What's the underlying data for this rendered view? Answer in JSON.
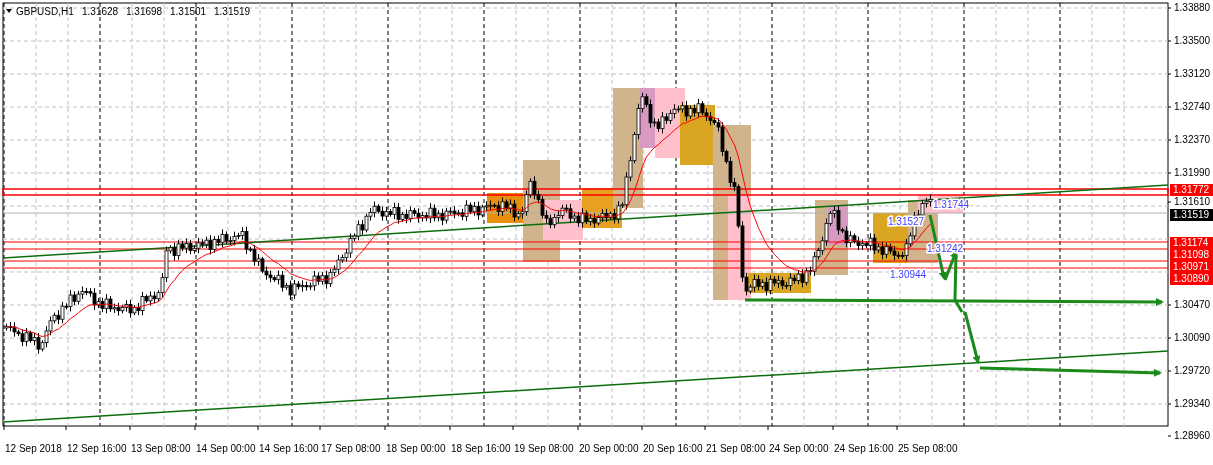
{
  "header": {
    "symbol": "GBPUSD,H1",
    "quotes": [
      "1.31628",
      "1.31698",
      "1.31501",
      "1.31519"
    ]
  },
  "price_axis": {
    "ticks": [
      "1.33880",
      "1.33500",
      "1.33120",
      "1.32740",
      "1.32370",
      "1.31990",
      "1.31610",
      "1.30470",
      "1.30090",
      "1.29720",
      "1.29340",
      "1.28960"
    ]
  },
  "price_labels": [
    {
      "text": "1.31772",
      "color": "#ff0000"
    },
    {
      "text": "1.31519",
      "color": "#000000"
    },
    {
      "text": "1.31174",
      "color": "#ff0000"
    },
    {
      "text": "1.31098",
      "color": "#ff0000"
    },
    {
      "text": "1.30971",
      "color": "#ff0000"
    },
    {
      "text": "1.30890",
      "color": "#ff0000"
    }
  ],
  "time_axis": {
    "ticks": [
      "12 Sep 2018",
      "12 Sep 16:00",
      "13 Sep 08:00",
      "14 Sep 00:00",
      "14 Sep 16:00",
      "17 Sep 08:00",
      "18 Sep 00:00",
      "18 Sep 16:00",
      "19 Sep 08:00",
      "20 Sep 00:00",
      "20 Sep 16:00",
      "21 Sep 08:00",
      "24 Sep 00:00",
      "24 Sep 16:00",
      "25 Sep 08:00"
    ]
  },
  "annotations": [
    "1.31744",
    "1.31527",
    "1.31242",
    "1.30944"
  ]
}
